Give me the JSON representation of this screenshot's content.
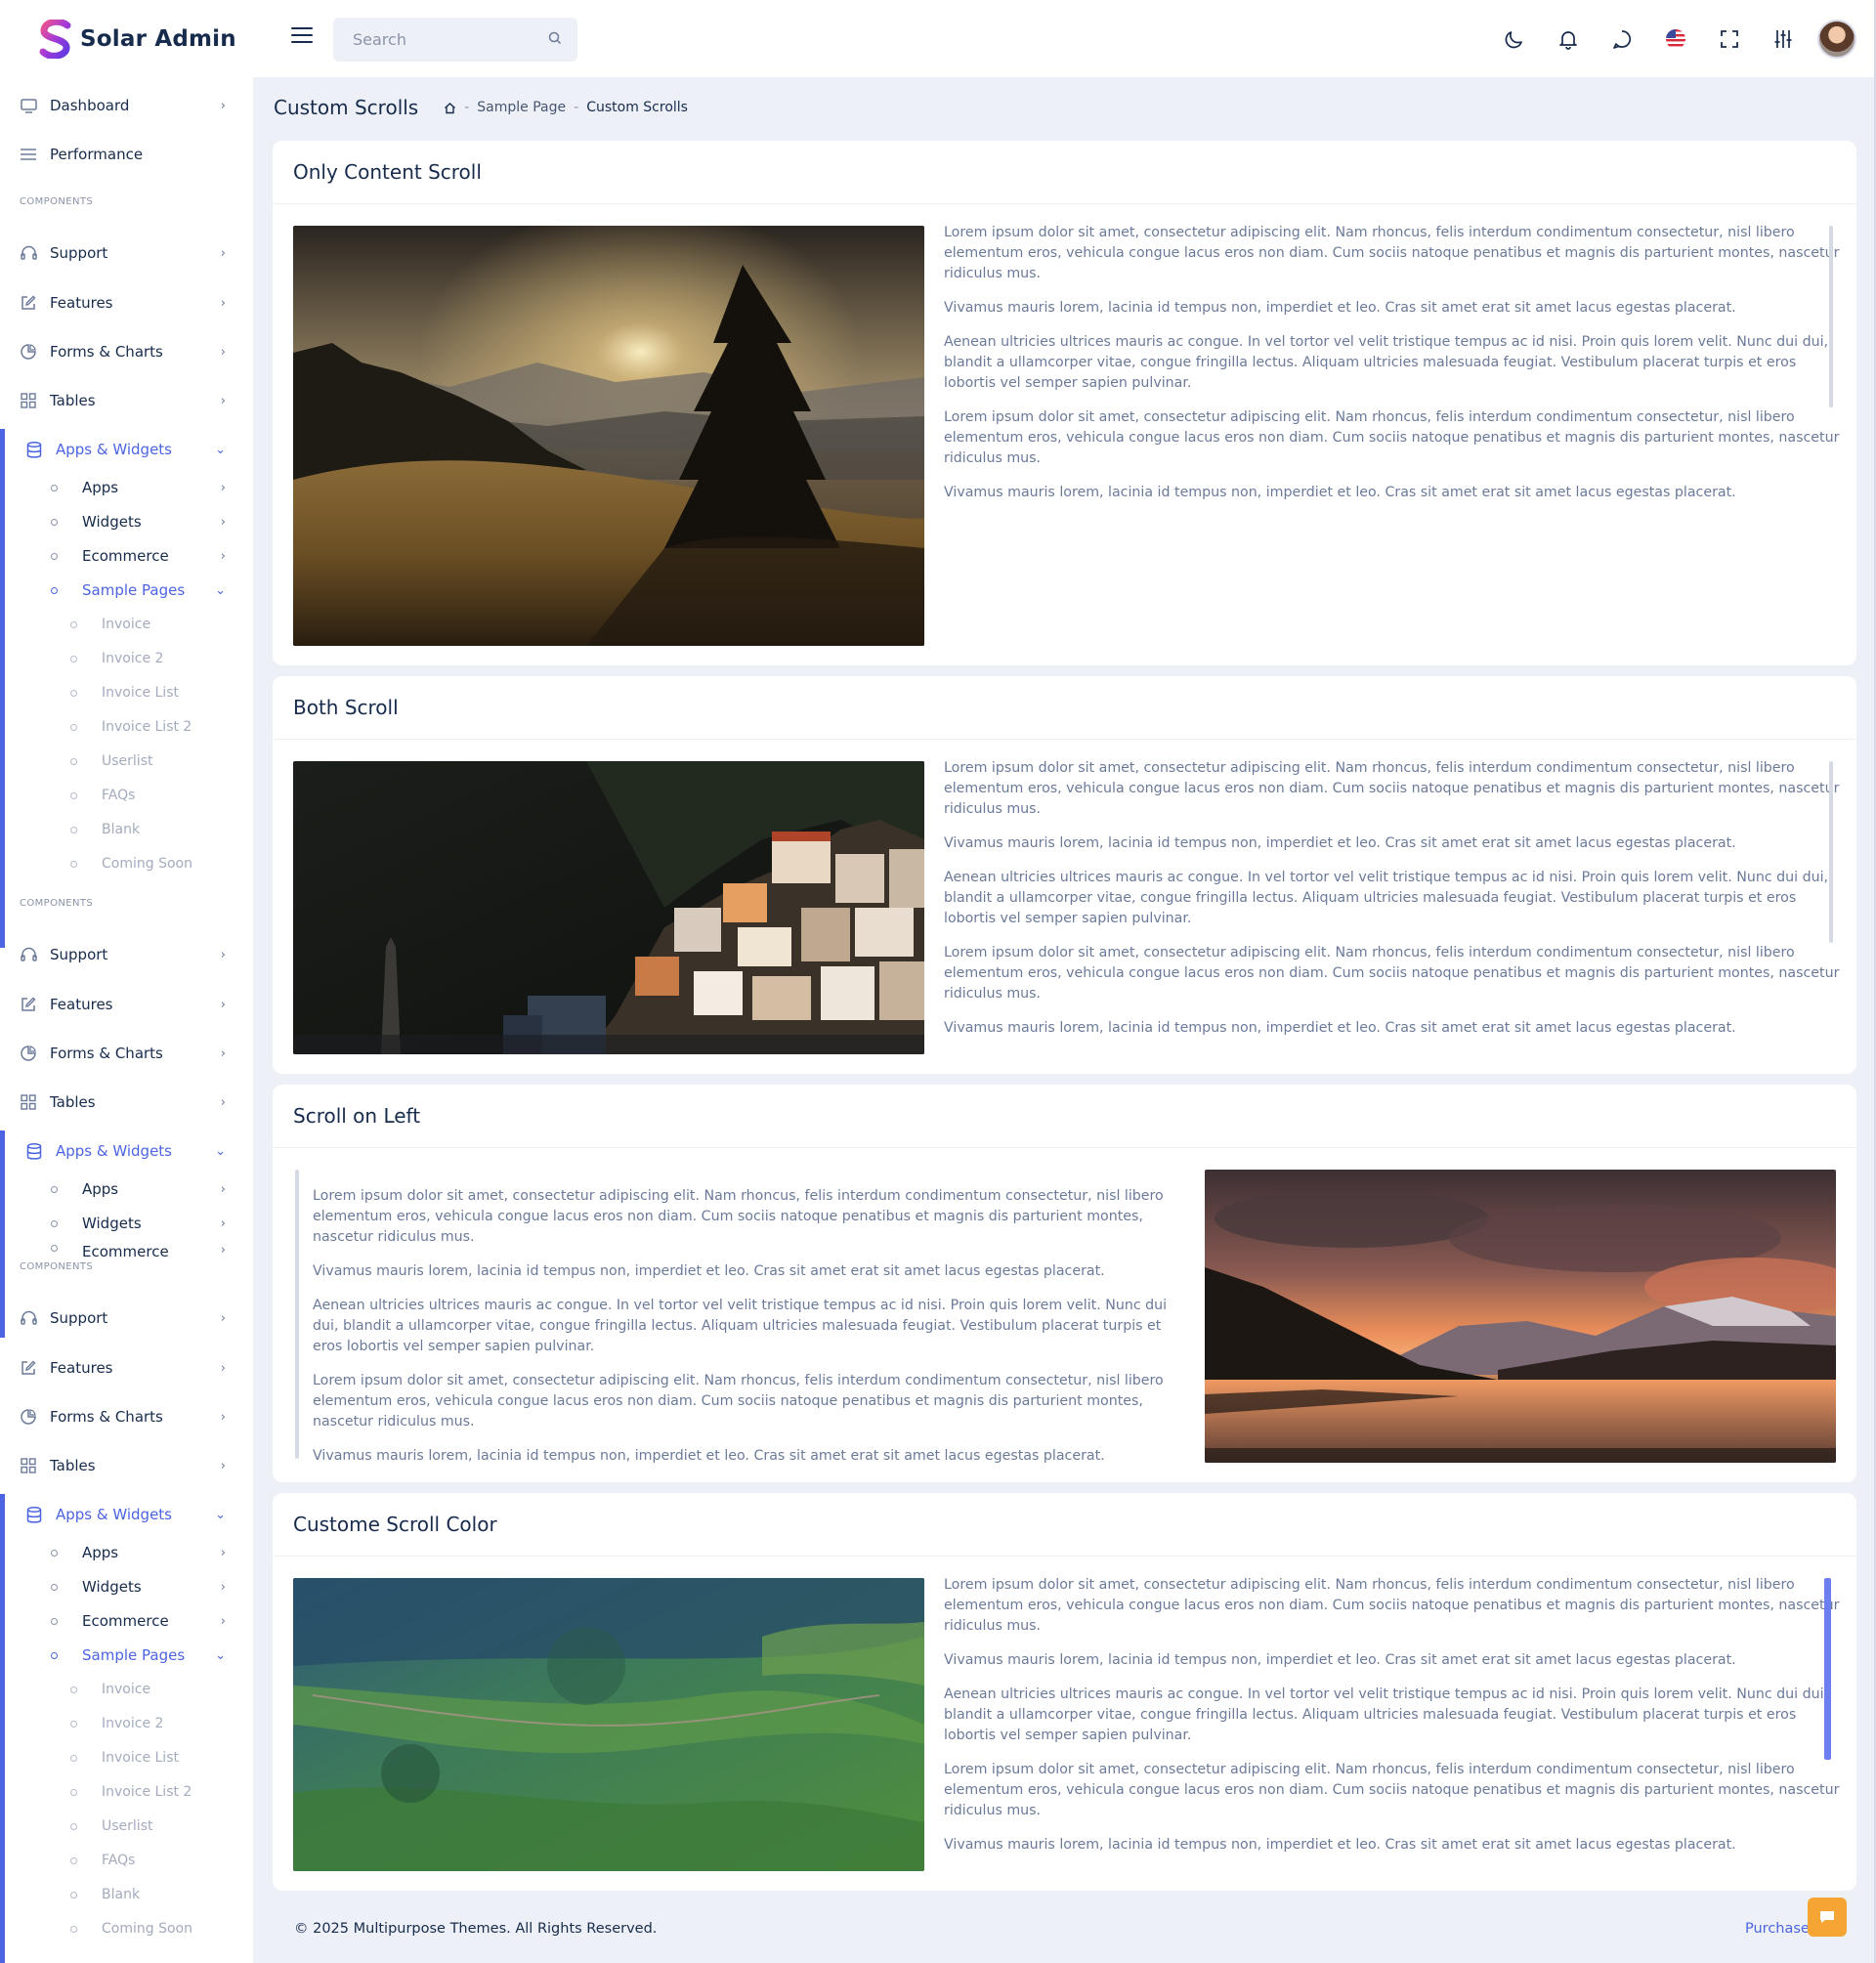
{
  "app": {
    "name": "Solar Admin",
    "search_placeholder": "Search"
  },
  "topbar_icons": [
    "moon-icon",
    "bell-icon",
    "chat-icon",
    "us-flag-icon",
    "fullscreen-icon",
    "sliders-icon",
    "avatar"
  ],
  "sidebar": {
    "dashboard": "Dashboard",
    "performance": "Performance",
    "section_heading": "COMPONENTS",
    "support": "Support",
    "features": "Features",
    "forms_charts": "Forms & Charts",
    "tables": "Tables",
    "apps_widgets": "Apps & Widgets",
    "apps": "Apps",
    "widgets": "Widgets",
    "ecommerce": "Ecommerce",
    "sample_pages": "Sample Pages",
    "sample_page_items": [
      "Invoice",
      "Invoice 2",
      "Invoice List",
      "Invoice List 2",
      "Userlist",
      "FAQs",
      "Blank",
      "Coming Soon"
    ]
  },
  "page": {
    "title": "Custom Scrolls",
    "breadcrumb": [
      "Sample Page",
      "Custom Scrolls"
    ]
  },
  "cards": {
    "only_content": "Only Content Scroll",
    "both": "Both Scroll",
    "left": "Scroll on Left",
    "color": "Custome Scroll Color"
  },
  "lorem": {
    "p1": "Lorem ipsum dolor sit amet, consectetur adipiscing elit. Nam rhoncus, felis interdum condimentum consectetur, nisl libero elementum eros, vehicula congue lacus eros non diam. Cum sociis natoque penatibus et magnis dis parturient montes, nascetur ridiculus mus.",
    "p2": "Vivamus mauris lorem, lacinia id tempus non, imperdiet et leo. Cras sit amet erat sit amet lacus egestas placerat.",
    "p3": "Aenean ultricies ultrices mauris ac congue. In vel tortor vel velit tristique tempus ac id nisi. Proin quis lorem velit. Nunc dui dui, blandit a ullamcorper vitae, congue fringilla lectus. Aliquam ultricies malesuada feugiat. Vestibulum placerat turpis et eros lobortis vel semper sapien pulvinar."
  },
  "footer": {
    "copyright": "© 2025 Multipurpose Themes. All Rights Reserved.",
    "purchase": "Purchase Now"
  },
  "colors": {
    "accent": "#4c64e1",
    "page_bg": "#eef0f7",
    "custom_scroll": "#6d7ff0",
    "fab": "#f4a534"
  }
}
